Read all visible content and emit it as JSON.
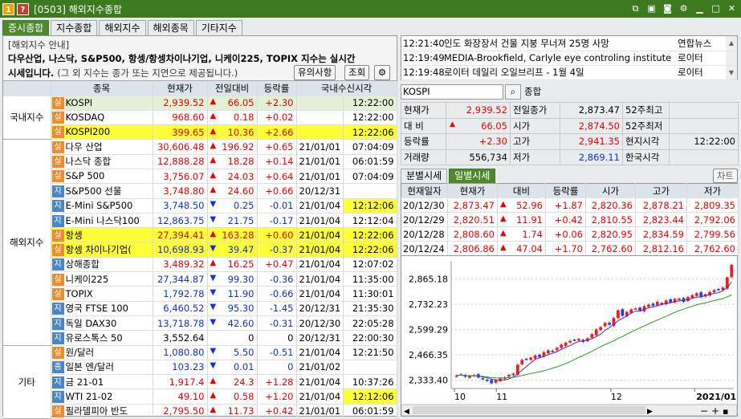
{
  "window": {
    "num": "1",
    "help": "?",
    "title": "[0503] 해외지수종합"
  },
  "tabs": [
    "증시종합",
    "지수종합",
    "해외지수",
    "해외종목",
    "기타지수"
  ],
  "notice": {
    "head": "[해외지수 안내]",
    "line1": "다우산업, 나스닥, S&P500, 항셍/항셍차이나기업, 니케이225, TOPIX 지수는 실시간",
    "line2": "시세입니다.",
    "small": "(그 외 지수는 종가 또는 지연으로 제공됩니다.)",
    "btn1": "유의사항",
    "btn2": "조회"
  },
  "left_headers": [
    "종목",
    "현재가",
    "전일대비",
    "등락률",
    "국내수신시각"
  ],
  "groups": [
    "국내지수",
    "해외지수",
    "기타"
  ],
  "rows": [
    {
      "badge": "실",
      "name": "KOSPI",
      "price": "2,939.52",
      "dir": "▲",
      "chg": "66.05",
      "pct": "+2.30",
      "date": "",
      "time": "12:22:00",
      "hl": "g",
      "tyl": false
    },
    {
      "badge": "실",
      "name": "KOSDAQ",
      "price": "968.60",
      "dir": "▲",
      "chg": "0.18",
      "pct": "+0.02",
      "date": "",
      "time": "12:22:00",
      "hl": "",
      "tyl": false
    },
    {
      "badge": "실",
      "name": "KOSPI200",
      "price": "399.65",
      "dir": "▲",
      "chg": "10.36",
      "pct": "+2.66",
      "date": "",
      "time": "12:22:06",
      "hl": "y",
      "tyl": true
    },
    {
      "badge": "실",
      "name": "다우 산업",
      "price": "30,606.48",
      "dir": "▲",
      "chg": "196.92",
      "pct": "+0.65",
      "date": "21/01/01",
      "time": "07:04:09",
      "hl": "",
      "tyl": false
    },
    {
      "badge": "실",
      "name": "나스닥 종합",
      "price": "12,888.28",
      "dir": "▲",
      "chg": "18.28",
      "pct": "+0.14",
      "date": "21/01/01",
      "time": "06:01:59",
      "hl": "",
      "tyl": false
    },
    {
      "badge": "실",
      "name": "S&P 500",
      "price": "3,756.07",
      "dir": "▲",
      "chg": "24.03",
      "pct": "+0.64",
      "date": "21/01/01",
      "time": "07:04:09",
      "hl": "",
      "tyl": false
    },
    {
      "badge": "지",
      "name": "S&P500 선물",
      "price": "3,748.80",
      "dir": "▲",
      "chg": "24.60",
      "pct": "+0.66",
      "date": "20/12/31",
      "time": "",
      "hl": "",
      "tyl": false
    },
    {
      "badge": "지",
      "name": "E-Mini S&P500",
      "price": "3,748.50",
      "dir": "▼",
      "chg": "0.25",
      "pct": "-0.01",
      "date": "21/01/04",
      "time": "12:12:06",
      "hl": "",
      "tyl": true
    },
    {
      "badge": "지",
      "name": "E-Mini 나스닥100",
      "price": "12,863.75",
      "dir": "▼",
      "chg": "21.75",
      "pct": "-0.17",
      "date": "21/01/04",
      "time": "12:12:04",
      "hl": "",
      "tyl": false
    },
    {
      "badge": "실",
      "name": "항셍",
      "price": "27,394.41",
      "dir": "▲",
      "chg": "163.28",
      "pct": "+0.60",
      "date": "21/01/04",
      "time": "12:22:06",
      "hl": "y",
      "tyl": true
    },
    {
      "badge": "실",
      "name": "항셍 차이나기업(",
      "price": "10,698.93",
      "dir": "▼",
      "chg": "39.47",
      "pct": "-0.37",
      "date": "21/01/04",
      "time": "12:22:06",
      "hl": "y",
      "tyl": true
    },
    {
      "badge": "지",
      "name": "상해종합",
      "price": "3,489.32",
      "dir": "▲",
      "chg": "16.25",
      "pct": "+0.47",
      "date": "21/01/04",
      "time": "12:07:02",
      "hl": "",
      "tyl": false
    },
    {
      "badge": "실",
      "name": "니케이225",
      "price": "27,344.87",
      "dir": "▼",
      "chg": "99.30",
      "pct": "-0.36",
      "date": "21/01/04",
      "time": "11:35:00",
      "hl": "",
      "tyl": false
    },
    {
      "badge": "실",
      "name": "TOPIX",
      "price": "1,792.78",
      "dir": "▼",
      "chg": "11.90",
      "pct": "-0.66",
      "date": "21/01/04",
      "time": "11:30:01",
      "hl": "",
      "tyl": false
    },
    {
      "badge": "지",
      "name": "영국 FTSE 100",
      "price": "6,460.52",
      "dir": "▼",
      "chg": "95.30",
      "pct": "-1.45",
      "date": "20/12/31",
      "time": "21:35:30",
      "hl": "",
      "tyl": false
    },
    {
      "badge": "지",
      "name": "독일 DAX30",
      "price": "13,718.78",
      "dir": "▼",
      "chg": "42.60",
      "pct": "-0.31",
      "date": "20/12/30",
      "time": "22:05:28",
      "hl": "",
      "tyl": false
    },
    {
      "badge": "지",
      "name": "유로스톡스 50",
      "price": "3,552.64",
      "dir": "",
      "chg": "0",
      "pct": "0",
      "date": "20/12/31",
      "time": "22:00:30",
      "hl": "",
      "tyl": false
    },
    {
      "badge": "실",
      "name": "원/달러",
      "price": "1,080.80",
      "dir": "▼",
      "chg": "5.50",
      "pct": "-0.51",
      "date": "21/01/04",
      "time": "12:21:50",
      "hl": "",
      "tyl": false
    },
    {
      "badge": "종",
      "name": "일본 엔/달러",
      "price": "103.23",
      "dir": "▼",
      "chg": "0.01",
      "pct": "0",
      "date": "21/01/02",
      "time": "",
      "hl": "",
      "tyl": false
    },
    {
      "badge": "지",
      "name": "금 21-01",
      "price": "1,917.4",
      "dir": "▲",
      "chg": "24.3",
      "pct": "+1.28",
      "date": "21/01/04",
      "time": "10:37:26",
      "hl": "",
      "tyl": false
    },
    {
      "badge": "지",
      "name": "WTI 21-02",
      "price": "49.10",
      "dir": "▲",
      "chg": "0.58",
      "pct": "+1.20",
      "date": "21/01/04",
      "time": "12:12:06",
      "hl": "",
      "tyl": true
    },
    {
      "badge": "실",
      "name": "필라델피아 반도",
      "price": "2,795.50",
      "dir": "▲",
      "chg": "11.73",
      "pct": "+0.42",
      "date": "21/01/01",
      "time": "06:01:59",
      "hl": "",
      "tyl": false
    }
  ],
  "news": [
    {
      "time": "12:21:40",
      "title": "인도 화장장서 건물 지붕 무너져 25명 사망",
      "src": "연합뉴스"
    },
    {
      "time": "12:19:49",
      "title": "MEDIA-Brookfield, Carlyle eye controling institute",
      "src": "로이터"
    },
    {
      "time": "12:19:48",
      "title": "로이터 데일리 오일브리프 - 1월 4일",
      "src": "로이터"
    }
  ],
  "search": {
    "value": "KOSPI",
    "btn": "종합"
  },
  "quote": {
    "현재가": "2,939.52",
    "전일종가": "2,873.47",
    "w52h": "52주최고",
    "대비dir": "▲",
    "대비": "66.05",
    "시가": "2,874.50",
    "w52l": "52주최저",
    "등락률": "+2.30",
    "고가": "2,941.35",
    "현지시각": "12:22:00",
    "거래량": "556,734",
    "저가": "2,869.11",
    "한국시각": "한국시각",
    "labels": [
      "현재가",
      "전일종가",
      "대 비",
      "시가",
      "등락률",
      "고가",
      "거래량",
      "저가",
      "현지시각"
    ]
  },
  "subtabs": [
    "분별시세",
    "일별시세"
  ],
  "chart_btn": "차트",
  "daily_headers": [
    "현재일자",
    "현재가",
    "대비",
    "등락률",
    "시가",
    "고가",
    "저가"
  ],
  "daily": [
    {
      "date": "20/12/30",
      "price": "2,873.47",
      "dir": "▲",
      "chg": "52.96",
      "pct": "+1.87",
      "open": "2,820.36",
      "high": "2,878.21",
      "low": "2,809.35"
    },
    {
      "date": "20/12/29",
      "price": "2,820.51",
      "dir": "▲",
      "chg": "11.91",
      "pct": "+0.42",
      "open": "2,810.55",
      "high": "2,823.44",
      "low": "2,792.06"
    },
    {
      "date": "20/12/28",
      "price": "2,808.60",
      "dir": "▲",
      "chg": "1.74",
      "pct": "+0.06",
      "open": "2,820.95",
      "high": "2,834.59",
      "low": "2,799.56"
    },
    {
      "date": "20/12/24",
      "price": "2,806.86",
      "dir": "▲",
      "chg": "47.04",
      "pct": "+1.70",
      "open": "2,762.60",
      "high": "2,812.16",
      "low": "2,762.60"
    }
  ],
  "chart_data": {
    "type": "candlestick",
    "ytick_labels": [
      "2,865.18",
      "2,732.23",
      "2,599.29",
      "2,466.35",
      "2,333.40"
    ],
    "ylim": [
      2290,
      2960
    ],
    "xtick_labels": [
      "10",
      "11",
      "12",
      "2021/01"
    ],
    "close": [
      2358,
      2362,
      2352,
      2355,
      2360,
      2348,
      2340,
      2330,
      2318,
      2335,
      2342,
      2347,
      2361,
      2368,
      2415,
      2440,
      2445,
      2452,
      2463,
      2455,
      2480,
      2490,
      2486,
      2503,
      2520,
      2530,
      2540,
      2545,
      2550,
      2535,
      2553,
      2575,
      2600,
      2612,
      2634,
      2625,
      2660,
      2700,
      2672,
      2692,
      2705,
      2710,
      2700,
      2722,
      2730,
      2725,
      2745,
      2733,
      2752,
      2743,
      2760,
      2762,
      2745,
      2770,
      2780,
      2790,
      2770,
      2784,
      2797,
      2806,
      2808,
      2820,
      2873,
      2939
    ],
    "up_color": "#e82020",
    "down_color": "#2040e0",
    "ma_colors": [
      "#6020c0",
      "#20a020"
    ]
  }
}
